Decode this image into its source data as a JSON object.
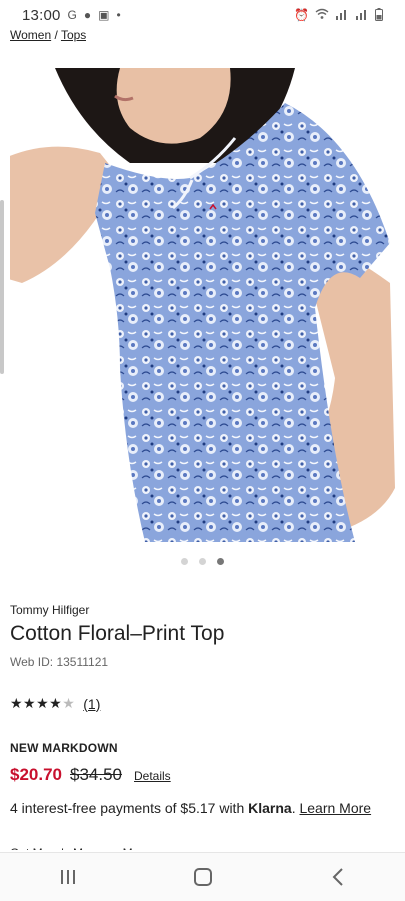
{
  "status_bar": {
    "time": "13:00",
    "left_icons": [
      "google-icon",
      "account-icon",
      "screenshot-icon",
      "dot-icon"
    ],
    "right_icons": [
      "alarm-icon",
      "wifi-icon",
      "signal-icon",
      "signal-icon",
      "battery-icon"
    ]
  },
  "breadcrumb": {
    "women": "Women",
    "separator": "/",
    "tops": "Tops"
  },
  "product": {
    "brand": "Tommy Hilfiger",
    "title": "Cotton Floral–Print Top",
    "web_id": "Web ID: 13511121",
    "rating_stars": 4,
    "review_count": "(1)",
    "markdown_label": "NEW MARKDOWN",
    "sale_price": "$20.70",
    "original_price": "$34.50",
    "details_label": "Details",
    "klarna": {
      "prefix": "4 interest-free payments of $5.17 with ",
      "brand": "Klarna",
      "suffix": ". ",
      "link": "Learn More"
    },
    "cutoff_text": "Get Macy's Money + More"
  },
  "carousel": {
    "count": 3,
    "active_index": 2
  },
  "colors": {
    "sale_red": "#c8102e",
    "shirt_blue": "#7e9bd6"
  }
}
